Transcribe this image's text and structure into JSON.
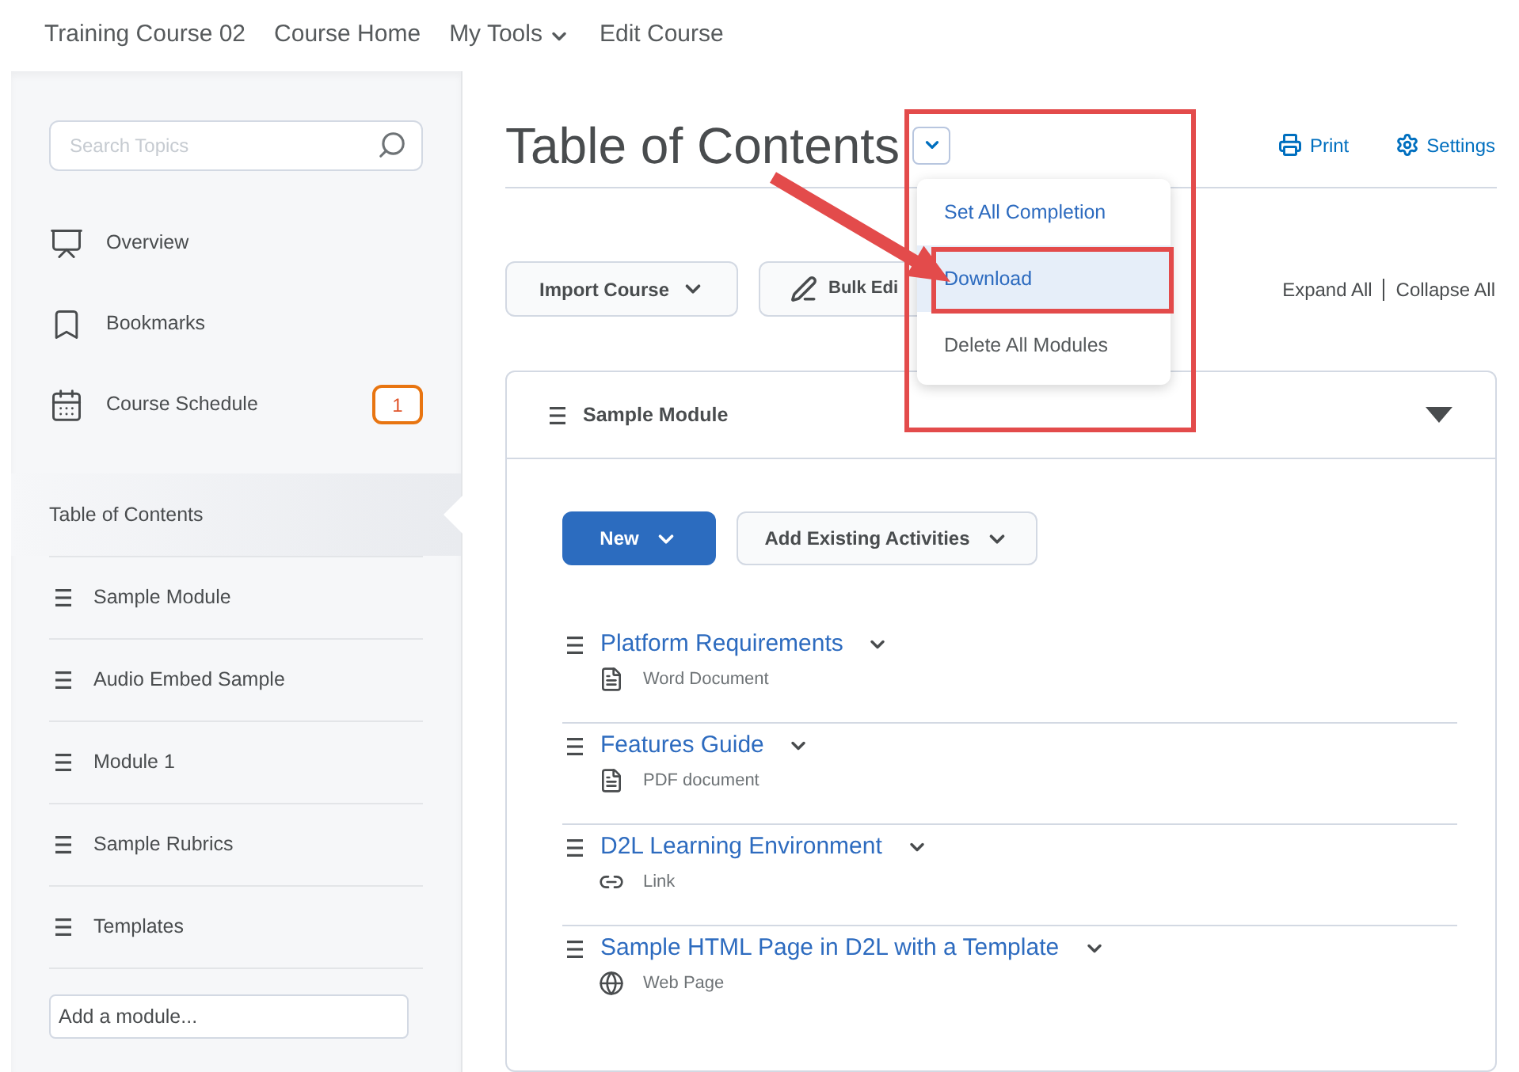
{
  "nav": [
    {
      "label": "Training Course 02",
      "has_menu": false
    },
    {
      "label": "Course Home",
      "has_menu": false
    },
    {
      "label": "My Tools",
      "has_menu": true
    },
    {
      "label": "Edit Course",
      "has_menu": false
    }
  ],
  "sidebar": {
    "search": {
      "placeholder": "Search Topics"
    },
    "tools": [
      {
        "kind": "overview",
        "label": "Overview"
      },
      {
        "kind": "bookmarks",
        "label": "Bookmarks"
      },
      {
        "kind": "schedule",
        "label": "Course Schedule",
        "badge": "1"
      }
    ],
    "toc": {
      "label": "Table of Contents",
      "selected": true
    },
    "modules": [
      {
        "label": "Sample Module"
      },
      {
        "label": "Audio Embed Sample"
      },
      {
        "label": "Module 1"
      },
      {
        "label": "Sample Rubrics"
      },
      {
        "label": "Templates"
      }
    ],
    "add_module": {
      "placeholder": "Add a module..."
    }
  },
  "main": {
    "title": "Table of Contents",
    "title_menu_expanded": true,
    "actions": [
      {
        "kind": "print",
        "label": "Print"
      },
      {
        "kind": "settings",
        "label": "Settings"
      }
    ],
    "toolbar": [
      {
        "kind": "import",
        "label": "Import Course"
      },
      {
        "kind": "bulk",
        "label": "Bulk Edi"
      }
    ],
    "expand_all": "Expand All",
    "collapse_all": "Collapse All",
    "menu": [
      {
        "label": "Set All Completion",
        "selected": false
      },
      {
        "label": "Download",
        "selected": true
      },
      {
        "label": "Delete All Modules",
        "selected": false
      }
    ],
    "module": {
      "title": "Sample Module",
      "expanded": true,
      "buttons": [
        {
          "kind": "primary",
          "label": "New"
        },
        {
          "kind": "secondary",
          "label": "Add Existing Activities"
        }
      ],
      "topics": [
        {
          "kind": "document",
          "title": "Platform Requirements",
          "type": "Word Document"
        },
        {
          "kind": "document",
          "title": "Features Guide",
          "type": "PDF document"
        },
        {
          "kind": "link",
          "title": "D2L Learning Environment",
          "type": "Link"
        },
        {
          "kind": "web",
          "title": "Sample HTML Page in D2L with a Template",
          "type": "Web Page"
        }
      ]
    }
  },
  "annotations": {
    "highlight_menu": true,
    "highlight_item": true,
    "arrow": true
  }
}
